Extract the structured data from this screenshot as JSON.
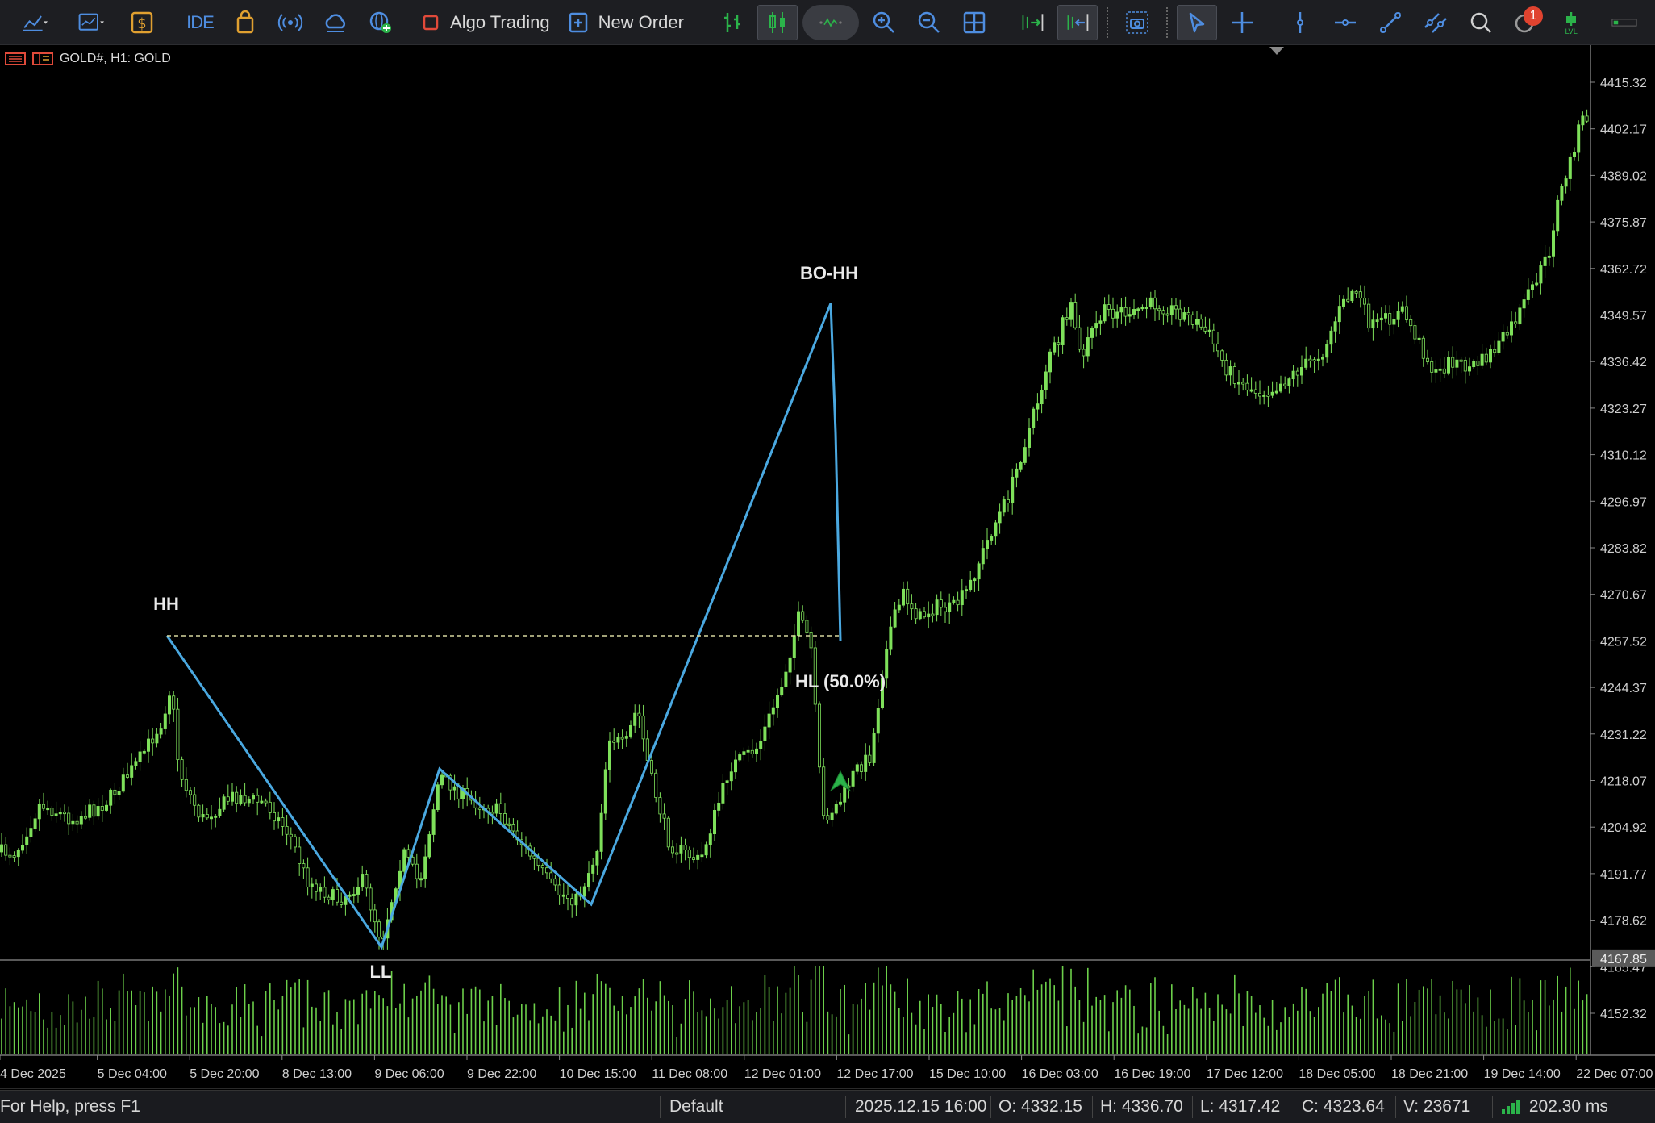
{
  "toolbar": {
    "algo_trading_label": "Algo Trading",
    "new_order_label": "New Order",
    "ide_label": "IDE",
    "notification_count": "1",
    "notification_badge_color": "#e0432f"
  },
  "chart": {
    "symbol_title": "GOLD#, H1:  GOLD",
    "price_axis_labels": [
      "4415.32",
      "4402.17",
      "4389.02",
      "4375.87",
      "4362.72",
      "4349.57",
      "4336.42",
      "4323.27",
      "4310.12",
      "4296.97",
      "4283.82",
      "4270.67",
      "4257.52",
      "4244.37",
      "4231.22",
      "4218.07",
      "4204.92",
      "4191.77",
      "4178.62",
      "4165.47",
      "4152.32"
    ],
    "current_price_label": "4167.85",
    "time_axis_labels": [
      "4 Dec 2025",
      "5 Dec 04:00",
      "5 Dec 20:00",
      "8 Dec 13:00",
      "9 Dec 06:00",
      "9 Dec 22:00",
      "10 Dec 15:00",
      "11 Dec 08:00",
      "12 Dec 01:00",
      "12 Dec 17:00",
      "15 Dec 10:00",
      "16 Dec 03:00",
      "16 Dec 19:00",
      "17 Dec 12:00",
      "18 Dec 05:00",
      "18 Dec 21:00",
      "19 Dec 14:00",
      "22 Dec 07:00"
    ],
    "annotations": {
      "hh": "HH",
      "ll": "LL",
      "bo_hh": "BO-HH",
      "hl": "HL (50.0%)"
    },
    "colors": {
      "candle": "#7ee05a",
      "zigzag": "#4aa8e0",
      "level_line": "#d8d8a0",
      "volume": "#6ccf4a"
    }
  },
  "statusbar": {
    "help_text": "For Help, press F1",
    "profile": "Default",
    "datetime": "2025.12.15 16:00",
    "open": "O: 4332.15",
    "high": "H: 4336.70",
    "low": "L: 4317.42",
    "close": "C: 4323.64",
    "volume": "V: 23671",
    "ping": "202.30 ms"
  }
}
